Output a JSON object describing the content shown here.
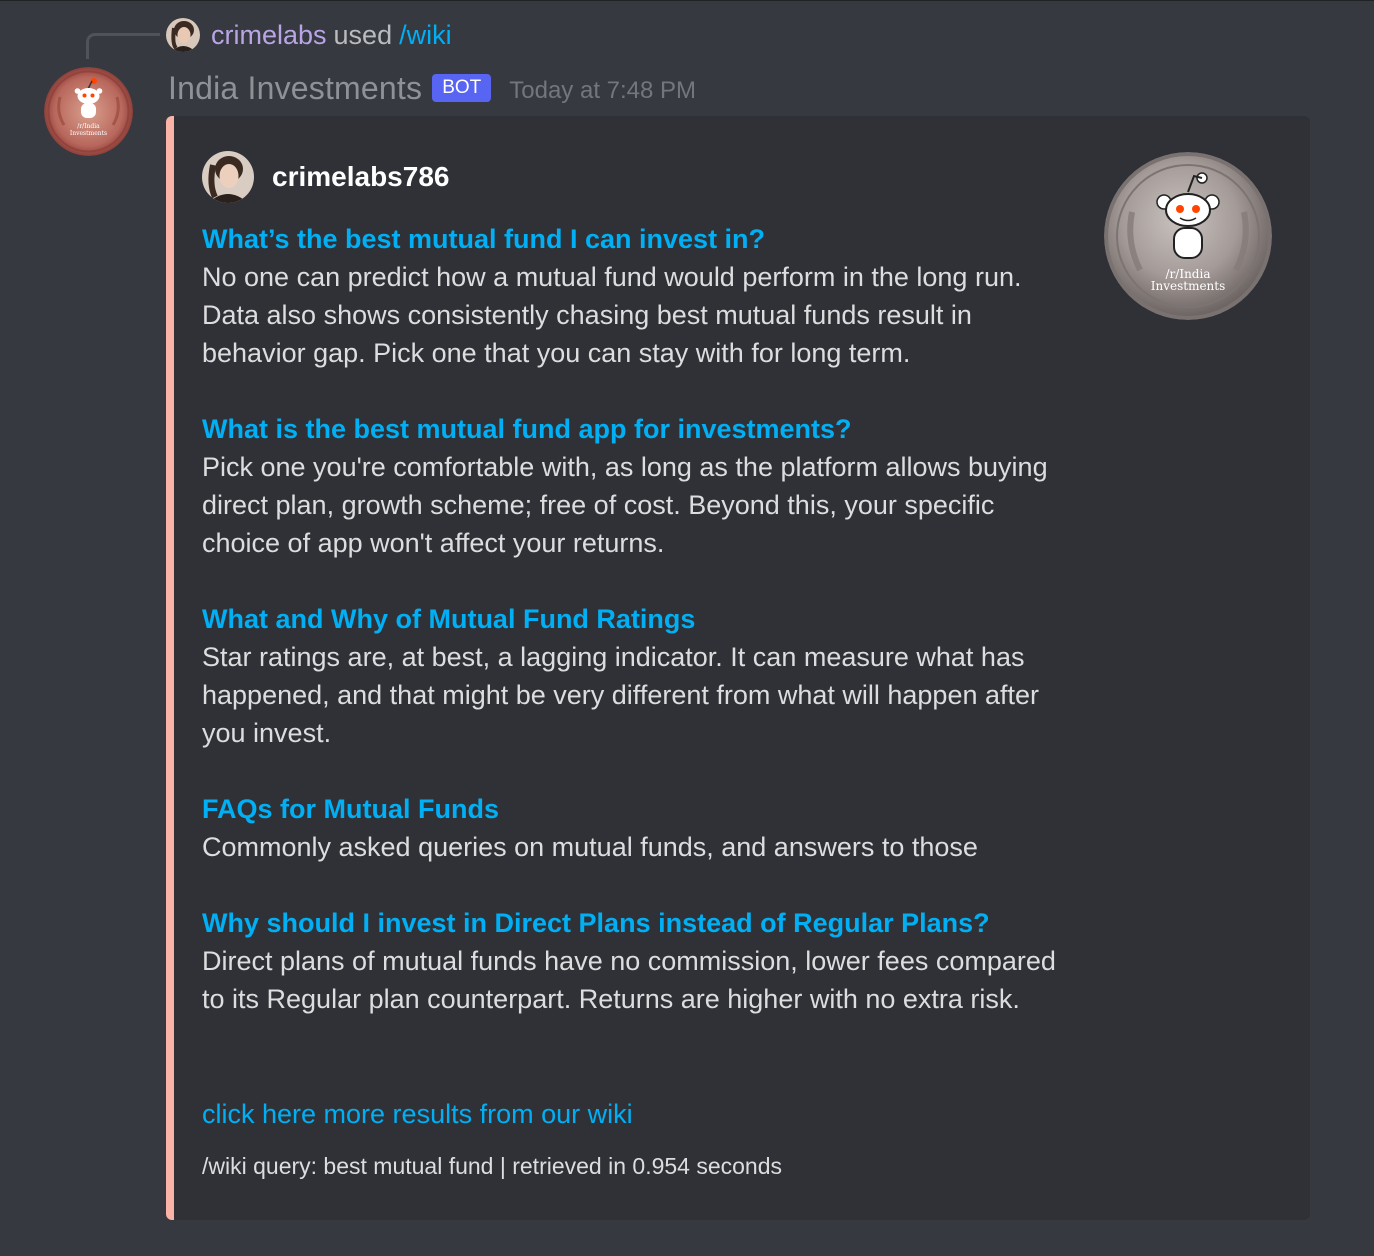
{
  "reply": {
    "user": "crimelabs",
    "used": "used",
    "command": "/wiki"
  },
  "message": {
    "bot_name": "India Investments",
    "badge": "BOT",
    "timestamp": "Today at 7:48 PM"
  },
  "embed": {
    "accent_color": "#f9b4a7",
    "author": "crimelabs786",
    "thumbnail_text": [
      "/r/India",
      "Investments"
    ],
    "faqs": [
      {
        "title": "What’s the best mutual fund I can invest in?",
        "body": "No one can predict how a mutual fund would perform in the long run. Data also shows consistently chasing best mutual funds result in behavior gap. Pick one that you can stay with for long term."
      },
      {
        "title": "What is the best mutual fund app for investments?",
        "body": "Pick one you're comfortable with, as long as the platform allows buying direct plan, growth scheme; free of cost. Beyond this, your specific choice of app won't affect your returns."
      },
      {
        "title": "What and Why of Mutual Fund Ratings",
        "body": "Star ratings are, at best, a lagging indicator. It can measure what has happened, and that might be very different from what will happen after you invest."
      },
      {
        "title": "FAQs for Mutual Funds",
        "body": "Commonly asked queries on mutual funds, and answers to those"
      },
      {
        "title": "Why should I invest in Direct Plans instead of Regular Plans?",
        "body": "Direct plans of mutual funds have no commission, lower fees compared to its Regular plan counterpart. Returns are higher with no extra risk."
      }
    ],
    "more_link": "click here more results from our wiki",
    "footer": "/wiki query: best mutual fund | retrieved in 0.954 seconds"
  },
  "colors": {
    "background": "#36393f",
    "embed_background": "#2f3136",
    "link": "#00aff4",
    "badge": "#5865f2"
  }
}
